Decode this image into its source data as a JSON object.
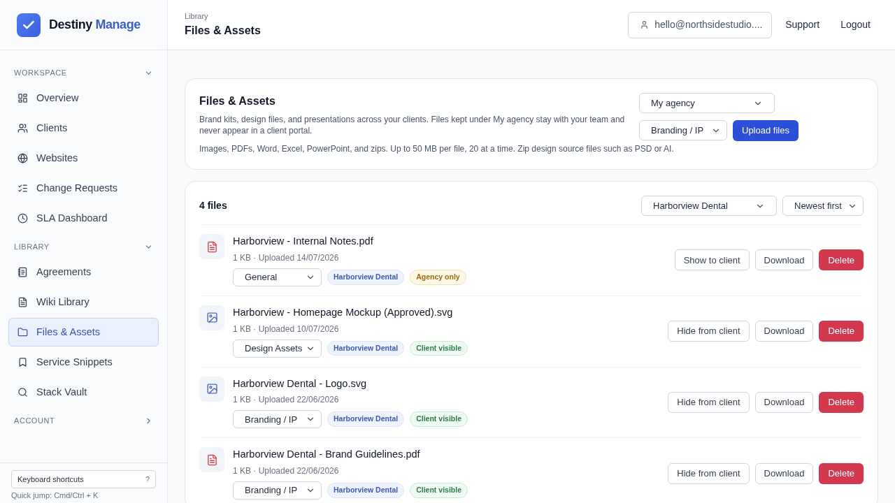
{
  "brand": {
    "name": "Destiny",
    "accent": "Manage"
  },
  "sidebar": {
    "sections": [
      {
        "title": "WORKSPACE",
        "expanded": true,
        "items": [
          {
            "label": "Overview",
            "selected": false
          },
          {
            "label": "Clients",
            "selected": false
          },
          {
            "label": "Websites",
            "selected": false
          },
          {
            "label": "Change Requests",
            "selected": false
          },
          {
            "label": "SLA Dashboard",
            "selected": false
          }
        ]
      },
      {
        "title": "LIBRARY",
        "expanded": true,
        "items": [
          {
            "label": "Agreements",
            "selected": false
          },
          {
            "label": "Wiki Library",
            "selected": false
          },
          {
            "label": "Files & Assets",
            "selected": true
          },
          {
            "label": "Service Snippets",
            "selected": false
          },
          {
            "label": "Stack Vault",
            "selected": false
          }
        ]
      },
      {
        "title": "ACCOUNT",
        "expanded": false
      }
    ],
    "shortcuts": {
      "label": "Keyboard shortcuts",
      "key": "?"
    },
    "hint": "Quick jump: Cmd/Ctrl + K"
  },
  "header": {
    "breadcrumb": "Library",
    "title": "Files & Assets",
    "account": "hello@northsidestudio....",
    "links": [
      "Support",
      "Logout"
    ]
  },
  "upload": {
    "title": "Files & Assets",
    "description": "Brand kits, design files, and presentations across your clients. Files kept under My agency stay with your team and never appear in a client portal.",
    "note": "Images, PDFs, Word, Excel, PowerPoint, and zips. Up to 50 MB per file, 20 at a time. Zip design source files such as PSD or AI.",
    "owner": "My agency",
    "category": "Branding / IP",
    "button": "Upload files"
  },
  "files": {
    "count": "4 files",
    "client_filter": "Harborview Dental",
    "sort": "Newest first",
    "rows": [
      {
        "name": "Harborview - Internal Notes.pdf",
        "kind": "document",
        "meta": "1 KB · Uploaded 14/07/2026",
        "category": "General",
        "client": "Harborview Dental",
        "visibility": {
          "kind": "agency",
          "label": "Agency only"
        },
        "toggle": "Show to client",
        "download": "Download",
        "delete": "Delete"
      },
      {
        "name": "Harborview - Homepage Mockup (Approved).svg",
        "kind": "image",
        "meta": "1 KB · Uploaded 10/07/2026",
        "category": "Design Assets",
        "client": "Harborview Dental",
        "visibility": {
          "kind": "client",
          "label": "Client visible"
        },
        "toggle": "Hide from client",
        "download": "Download",
        "delete": "Delete"
      },
      {
        "name": "Harborview Dental - Logo.svg",
        "kind": "image",
        "meta": "1 KB · Uploaded 22/06/2026",
        "category": "Branding / IP",
        "client": "Harborview Dental",
        "visibility": {
          "kind": "client",
          "label": "Client visible"
        },
        "toggle": "Hide from client",
        "download": "Download",
        "delete": "Delete"
      },
      {
        "name": "Harborview Dental - Brand Guidelines.pdf",
        "kind": "document",
        "meta": "1 KB · Uploaded 22/06/2026",
        "category": "Branding / IP",
        "client": "Harborview Dental",
        "visibility": {
          "kind": "client",
          "label": "Client visible"
        },
        "toggle": "Hide from client",
        "download": "Download",
        "delete": "Delete"
      }
    ]
  }
}
